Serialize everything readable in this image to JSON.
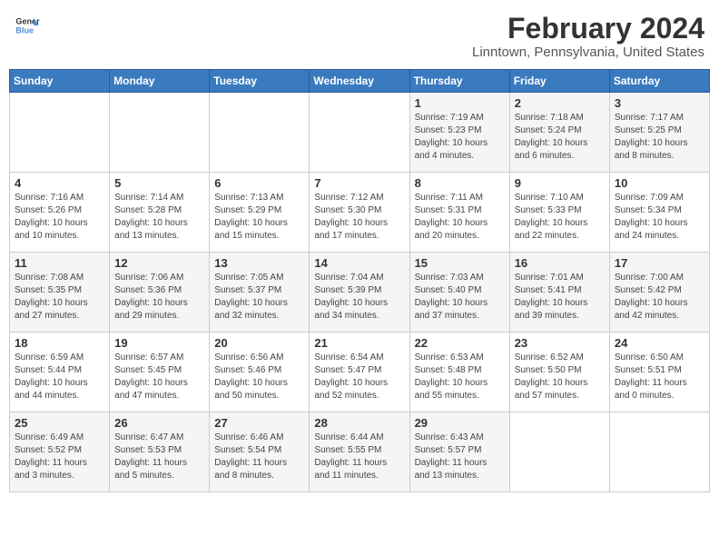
{
  "header": {
    "logo_line1": "General",
    "logo_line2": "Blue",
    "title": "February 2024",
    "subtitle": "Linntown, Pennsylvania, United States"
  },
  "days_of_week": [
    "Sunday",
    "Monday",
    "Tuesday",
    "Wednesday",
    "Thursday",
    "Friday",
    "Saturday"
  ],
  "weeks": [
    [
      {
        "day": "",
        "detail": ""
      },
      {
        "day": "",
        "detail": ""
      },
      {
        "day": "",
        "detail": ""
      },
      {
        "day": "",
        "detail": ""
      },
      {
        "day": "1",
        "detail": "Sunrise: 7:19 AM\nSunset: 5:23 PM\nDaylight: 10 hours\nand 4 minutes."
      },
      {
        "day": "2",
        "detail": "Sunrise: 7:18 AM\nSunset: 5:24 PM\nDaylight: 10 hours\nand 6 minutes."
      },
      {
        "day": "3",
        "detail": "Sunrise: 7:17 AM\nSunset: 5:25 PM\nDaylight: 10 hours\nand 8 minutes."
      }
    ],
    [
      {
        "day": "4",
        "detail": "Sunrise: 7:16 AM\nSunset: 5:26 PM\nDaylight: 10 hours\nand 10 minutes."
      },
      {
        "day": "5",
        "detail": "Sunrise: 7:14 AM\nSunset: 5:28 PM\nDaylight: 10 hours\nand 13 minutes."
      },
      {
        "day": "6",
        "detail": "Sunrise: 7:13 AM\nSunset: 5:29 PM\nDaylight: 10 hours\nand 15 minutes."
      },
      {
        "day": "7",
        "detail": "Sunrise: 7:12 AM\nSunset: 5:30 PM\nDaylight: 10 hours\nand 17 minutes."
      },
      {
        "day": "8",
        "detail": "Sunrise: 7:11 AM\nSunset: 5:31 PM\nDaylight: 10 hours\nand 20 minutes."
      },
      {
        "day": "9",
        "detail": "Sunrise: 7:10 AM\nSunset: 5:33 PM\nDaylight: 10 hours\nand 22 minutes."
      },
      {
        "day": "10",
        "detail": "Sunrise: 7:09 AM\nSunset: 5:34 PM\nDaylight: 10 hours\nand 24 minutes."
      }
    ],
    [
      {
        "day": "11",
        "detail": "Sunrise: 7:08 AM\nSunset: 5:35 PM\nDaylight: 10 hours\nand 27 minutes."
      },
      {
        "day": "12",
        "detail": "Sunrise: 7:06 AM\nSunset: 5:36 PM\nDaylight: 10 hours\nand 29 minutes."
      },
      {
        "day": "13",
        "detail": "Sunrise: 7:05 AM\nSunset: 5:37 PM\nDaylight: 10 hours\nand 32 minutes."
      },
      {
        "day": "14",
        "detail": "Sunrise: 7:04 AM\nSunset: 5:39 PM\nDaylight: 10 hours\nand 34 minutes."
      },
      {
        "day": "15",
        "detail": "Sunrise: 7:03 AM\nSunset: 5:40 PM\nDaylight: 10 hours\nand 37 minutes."
      },
      {
        "day": "16",
        "detail": "Sunrise: 7:01 AM\nSunset: 5:41 PM\nDaylight: 10 hours\nand 39 minutes."
      },
      {
        "day": "17",
        "detail": "Sunrise: 7:00 AM\nSunset: 5:42 PM\nDaylight: 10 hours\nand 42 minutes."
      }
    ],
    [
      {
        "day": "18",
        "detail": "Sunrise: 6:59 AM\nSunset: 5:44 PM\nDaylight: 10 hours\nand 44 minutes."
      },
      {
        "day": "19",
        "detail": "Sunrise: 6:57 AM\nSunset: 5:45 PM\nDaylight: 10 hours\nand 47 minutes."
      },
      {
        "day": "20",
        "detail": "Sunrise: 6:56 AM\nSunset: 5:46 PM\nDaylight: 10 hours\nand 50 minutes."
      },
      {
        "day": "21",
        "detail": "Sunrise: 6:54 AM\nSunset: 5:47 PM\nDaylight: 10 hours\nand 52 minutes."
      },
      {
        "day": "22",
        "detail": "Sunrise: 6:53 AM\nSunset: 5:48 PM\nDaylight: 10 hours\nand 55 minutes."
      },
      {
        "day": "23",
        "detail": "Sunrise: 6:52 AM\nSunset: 5:50 PM\nDaylight: 10 hours\nand 57 minutes."
      },
      {
        "day": "24",
        "detail": "Sunrise: 6:50 AM\nSunset: 5:51 PM\nDaylight: 11 hours\nand 0 minutes."
      }
    ],
    [
      {
        "day": "25",
        "detail": "Sunrise: 6:49 AM\nSunset: 5:52 PM\nDaylight: 11 hours\nand 3 minutes."
      },
      {
        "day": "26",
        "detail": "Sunrise: 6:47 AM\nSunset: 5:53 PM\nDaylight: 11 hours\nand 5 minutes."
      },
      {
        "day": "27",
        "detail": "Sunrise: 6:46 AM\nSunset: 5:54 PM\nDaylight: 11 hours\nand 8 minutes."
      },
      {
        "day": "28",
        "detail": "Sunrise: 6:44 AM\nSunset: 5:55 PM\nDaylight: 11 hours\nand 11 minutes."
      },
      {
        "day": "29",
        "detail": "Sunrise: 6:43 AM\nSunset: 5:57 PM\nDaylight: 11 hours\nand 13 minutes."
      },
      {
        "day": "",
        "detail": ""
      },
      {
        "day": "",
        "detail": ""
      }
    ]
  ]
}
